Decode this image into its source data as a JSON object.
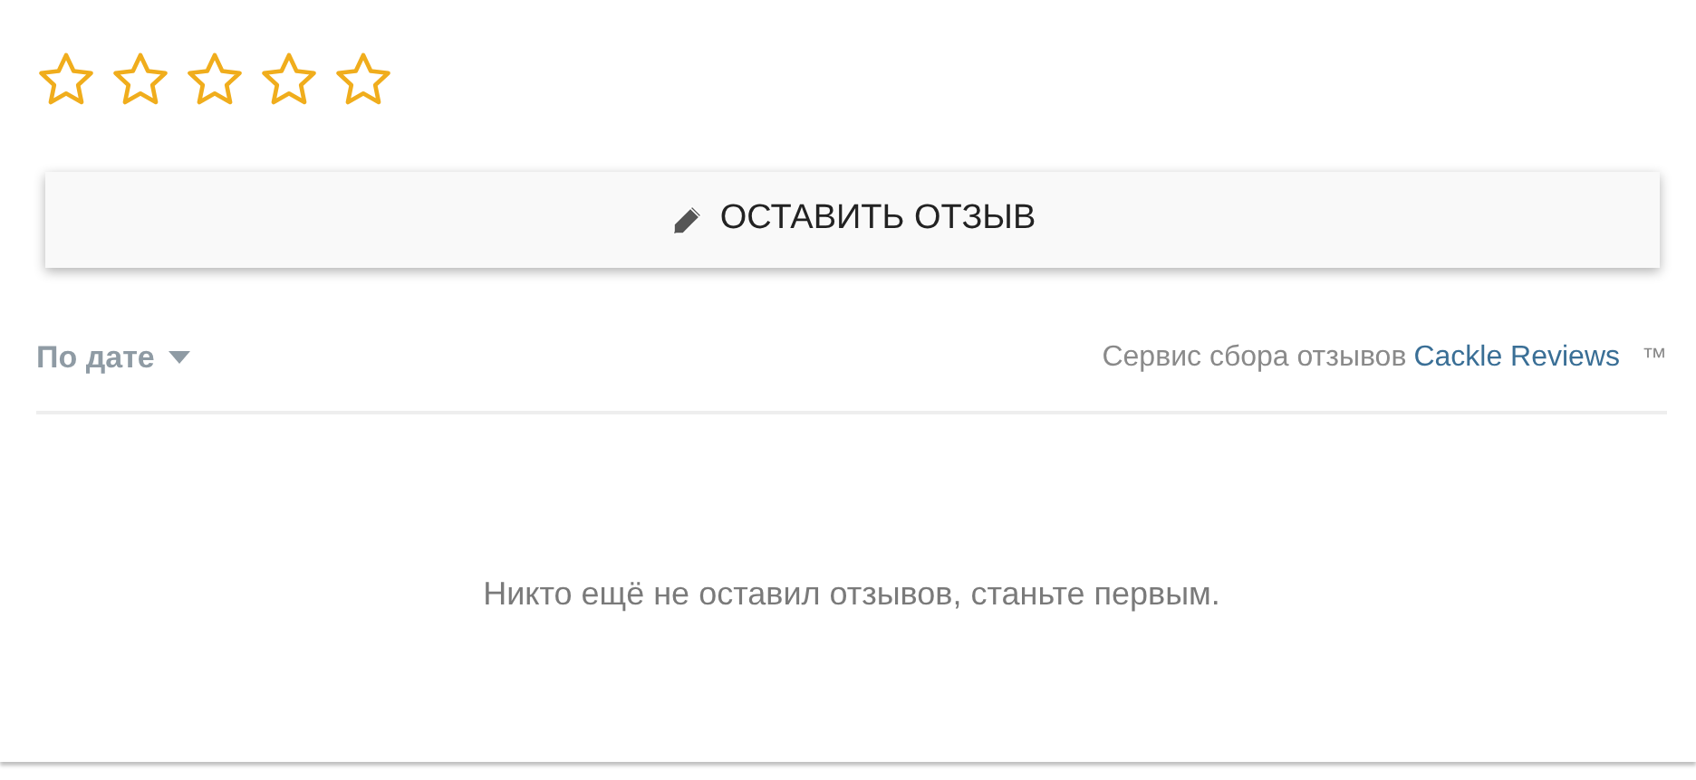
{
  "rating": {
    "stars": 0
  },
  "write_button": {
    "label": "ОСТАВИТЬ ОТЗЫВ"
  },
  "sort": {
    "label": "По дате"
  },
  "service": {
    "text": "Сервис сбора отзывов",
    "link": "Cackle Reviews",
    "mark": "™"
  },
  "empty_message": "Никто ещё не оставил отзывов, станьте первым."
}
